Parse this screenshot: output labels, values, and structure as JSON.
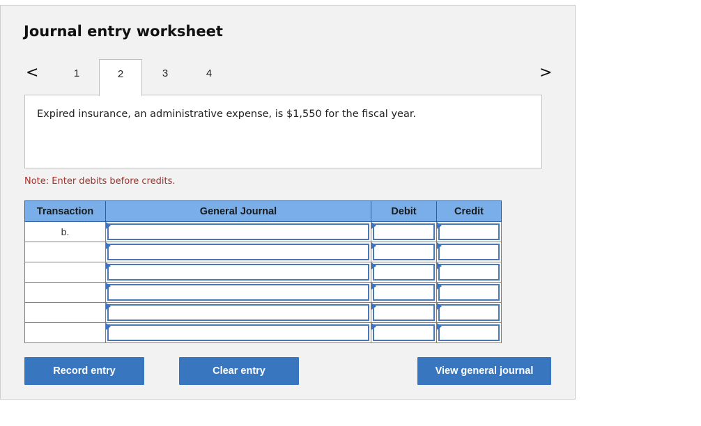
{
  "worksheet": {
    "title": "Journal entry worksheet",
    "prev_arrow": "<",
    "next_arrow": ">",
    "tabs": [
      {
        "label": "1",
        "active": false
      },
      {
        "label": "2",
        "active": true
      },
      {
        "label": "3",
        "active": false
      },
      {
        "label": "4",
        "active": false
      }
    ],
    "description": "Expired insurance, an administrative expense, is $1,550 for the fiscal year.",
    "note": "Note: Enter debits before credits."
  },
  "table": {
    "headers": {
      "transaction": "Transaction",
      "general_journal": "General Journal",
      "debit": "Debit",
      "credit": "Credit"
    },
    "rows": [
      {
        "transaction": "b.",
        "account": "",
        "debit": "",
        "credit": ""
      },
      {
        "transaction": "",
        "account": "",
        "debit": "",
        "credit": ""
      },
      {
        "transaction": "",
        "account": "",
        "debit": "",
        "credit": ""
      },
      {
        "transaction": "",
        "account": "",
        "debit": "",
        "credit": ""
      },
      {
        "transaction": "",
        "account": "",
        "debit": "",
        "credit": ""
      },
      {
        "transaction": "",
        "account": "",
        "debit": "",
        "credit": ""
      }
    ]
  },
  "buttons": {
    "record": "Record entry",
    "clear": "Clear entry",
    "view": "View general journal"
  },
  "colors": {
    "header_bg": "#7aaee8",
    "button_bg": "#3877bf",
    "note_text": "#a5312a",
    "field_border": "#4a78b5"
  }
}
